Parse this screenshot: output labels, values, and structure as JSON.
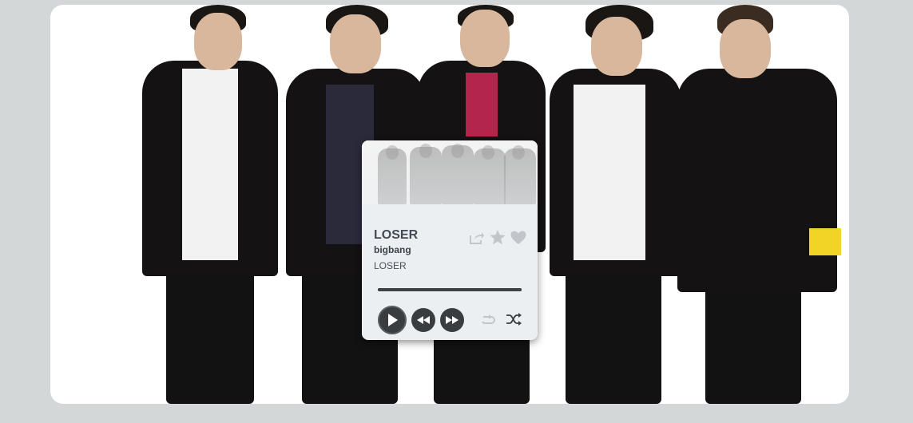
{
  "player": {
    "title": "LOSER",
    "artist": "bigbang",
    "album": "LOSER",
    "progress": 1.0,
    "icons": {
      "share": "share-icon",
      "favorite": "star-icon",
      "like": "heart-icon",
      "play": "play-icon",
      "rewind": "rewind-icon",
      "forward": "fast-forward-icon",
      "repeat": "repeat-icon",
      "shuffle": "shuffle-icon"
    }
  },
  "colors": {
    "page_background": "#d4d7d8",
    "card_background": "#eceff1",
    "control_dark": "#3a3d40",
    "text_primary": "#424b55"
  }
}
